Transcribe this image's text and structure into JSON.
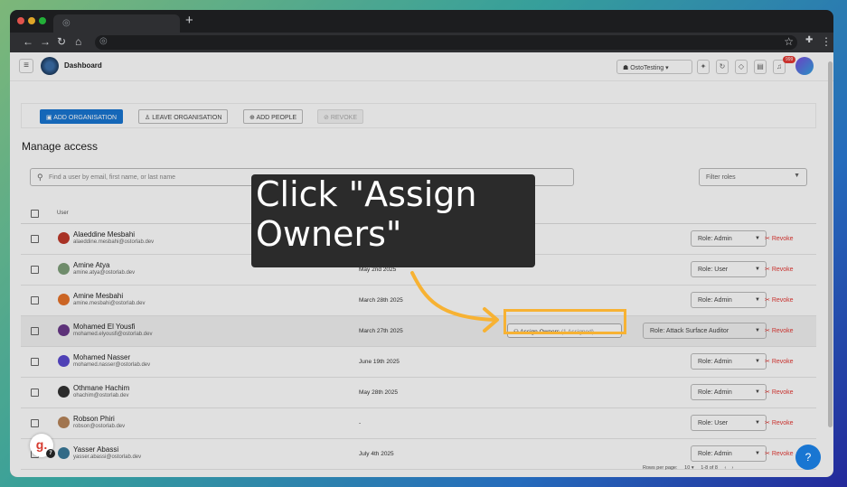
{
  "browser": {
    "dots": [
      "#ff5f57",
      "#febc2e",
      "#28c840"
    ],
    "new_tab": "+",
    "nav_icons": [
      "←",
      "→",
      "↻",
      "⌂"
    ]
  },
  "app": {
    "title": "Dashboard",
    "org": "OstoTesting",
    "notif_count": "999",
    "accent": "#1976d2",
    "revoke_color": "#e53935"
  },
  "actions": {
    "add_org": "ADD ORGANISATION",
    "leave_org": "LEAVE ORGANISATION",
    "add_people": "ADD PEOPLE",
    "revoke": "REVOKE"
  },
  "manage": {
    "title": "Manage access",
    "search_placeholder": "Find a user by email, first name, or last name",
    "filter_placeholder": "Filter roles"
  },
  "table": {
    "header_user": "User",
    "rows": [
      {
        "name": "Alaeddine Mesbahi",
        "email": "alaeddine.mesbahi@ostorlab.dev",
        "date": "",
        "role": "Role:  Admin",
        "revoke": "Revoke",
        "avatar": "#c0392b"
      },
      {
        "name": "Amine Atya",
        "email": "amine.atya@ostorlab.dev",
        "date": "May 2nd 2025",
        "role": "Role:  User",
        "revoke": "Revoke",
        "avatar": "#7fa07a"
      },
      {
        "name": "Amine Mesbahi",
        "email": "amine.mesbahi@ostorlab.dev",
        "date": "March 28th 2025",
        "role": "Role:  Admin",
        "revoke": "Revoke",
        "avatar": "#e8732a"
      },
      {
        "name": "Mohamed El Yousfi",
        "email": "mohamed.elyousfi@ostorlab.dev",
        "date": "March 27th 2025",
        "role": "Role:  Attack Surface Auditor",
        "revoke": "Revoke",
        "avatar": "#6a3a8a",
        "assign": "Assign Owners",
        "assigned": "(1 Assigned)"
      },
      {
        "name": "Mohamed Nasser",
        "email": "mohamed.nasser@ostorlab.dev",
        "date": "June 19th 2025",
        "role": "Role:  Admin",
        "revoke": "Revoke",
        "avatar": "#5a4ad0"
      },
      {
        "name": "Othmane Hachim",
        "email": "ohachim@ostorlab.dev",
        "date": "May 28th 2025",
        "role": "Role:  Admin",
        "revoke": "Revoke",
        "avatar": "#333333"
      },
      {
        "name": "Robson Phiri",
        "email": "robson@ostorlab.dev",
        "date": "-",
        "role": "Role:  User",
        "revoke": "Revoke",
        "avatar": "#b8865a"
      },
      {
        "name": "Yasser Abassi",
        "email": "yasser.abassi@ostorlab.dev",
        "date": "July 4th 2025",
        "role": "Role:  Admin",
        "revoke": "Revoke",
        "avatar": "#3a7a9a"
      }
    ]
  },
  "pagination": {
    "rows_per_page_label": "Rows per page:",
    "rows_per_page": "10",
    "range": "1-8 of 8"
  },
  "tooltip": {
    "text": "Click \"Assign Owners\""
  },
  "help": "?",
  "g_badge": "g.",
  "g_badge_count": "7"
}
